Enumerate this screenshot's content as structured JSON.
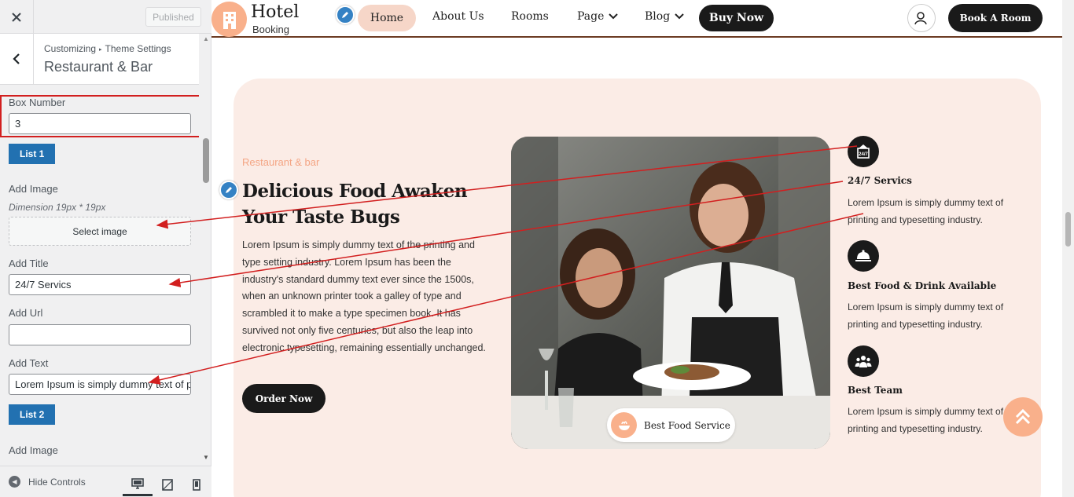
{
  "customizer": {
    "published_label": "Published",
    "breadcrumb_root": "Customizing",
    "breadcrumb_parent": "Theme Settings",
    "section_title": "Restaurant & Bar",
    "box_number_label": "Box Number",
    "box_number_value": "3",
    "list1_label": "List 1",
    "add_image_label": "Add Image",
    "dimension_text": "Dimension 19px * 19px",
    "select_image_label": "Select image",
    "add_title_label": "Add Title",
    "title_value": "24/7 Servics",
    "add_url_label": "Add Url",
    "url_value": "",
    "add_text_label": "Add Text",
    "text_value": "Lorem Ipsum is simply dummy text of printing",
    "list2_label": "List 2",
    "add_image_label_2": "Add Image",
    "hide_controls_label": "Hide Controls"
  },
  "site": {
    "logo_title": "Hotel",
    "logo_subtitle": "Booking",
    "nav": [
      "Home",
      "About Us",
      "Rooms",
      "Page",
      "Blog"
    ],
    "buy_now": "Buy Now",
    "book_room": "Book A Room",
    "eyebrow": "Restaurant & bar",
    "hero_title": "Delicious Food Awaken Your Taste Bugs",
    "hero_paragraph": "Lorem Ipsum is simply dummy text of the printing and type setting industry. Lorem Ipsum has been the industry's standard dummy text ever since the 1500s, when an unknown printer took a galley of type and scrambled it to make a type specimen book. It has survived not only five centuries, but also the leap into electronic typesetting, remaining essentially unchanged.",
    "order_now": "Order Now",
    "badge_text": "Best Food Service",
    "features": [
      {
        "icon": "24-7-sign-icon",
        "title": "24/7 Servics",
        "text": "Lorem Ipsum is simply dummy text of printing and typesetting industry."
      },
      {
        "icon": "food-cloche-icon",
        "title": "Best Food & Drink Available",
        "text": "Lorem Ipsum is simply dummy text of printing and typesetting industry."
      },
      {
        "icon": "team-icon",
        "title": "Best Team",
        "text": "Lorem Ipsum is simply dummy text of printing and typesetting industry."
      }
    ]
  },
  "colors": {
    "accent": "#f9b08b",
    "card_bg": "#fbece6",
    "dark": "#1a1a1a",
    "wp_blue": "#2271b1",
    "annotation_red": "#d21f1f"
  }
}
